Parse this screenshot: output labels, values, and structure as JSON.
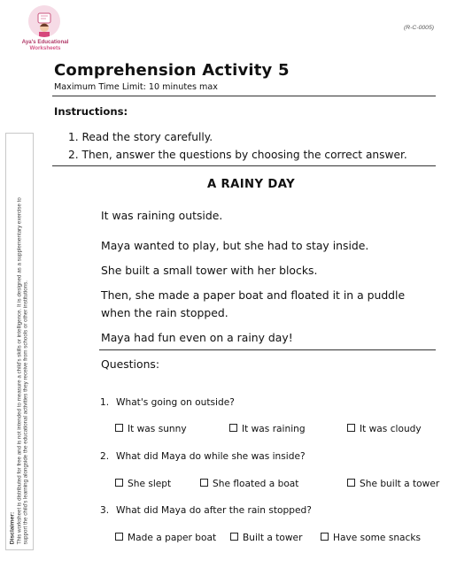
{
  "header": {
    "logo_line1": "Aya's Educational",
    "logo_line2": "Worksheets",
    "code": "(R-C-0005)",
    "title": "Comprehension Activity 5",
    "time_limit": "Maximum Time Limit: 10 minutes max"
  },
  "instructions": {
    "heading": "Instructions:",
    "items": [
      "1.  Read the story carefully.",
      "2.  Then, answer the questions by choosing the correct answer."
    ]
  },
  "story": {
    "title": "A RAINY DAY",
    "paragraphs": [
      "It was raining outside.",
      "Maya wanted to play, but she had to stay inside.",
      "She built a small tower with her blocks.",
      "Then, she made a paper boat and floated it in a puddle when the rain stopped.",
      "Maya had fun even on a rainy day!"
    ]
  },
  "questions": {
    "heading": "Questions:",
    "items": [
      {
        "num": "1.",
        "text": "What's going on outside?",
        "options": [
          "It was sunny",
          "It was raining",
          "It was cloudy"
        ]
      },
      {
        "num": "2.",
        "text": "What did Maya do while she was inside?",
        "options": [
          "She slept",
          "She floated a boat",
          "She built a tower"
        ]
      },
      {
        "num": "3.",
        "text": "What did Maya do after the rain stopped?",
        "options": [
          "Made a paper boat",
          "Built a tower",
          "Have some snacks"
        ]
      }
    ]
  },
  "disclaimer": {
    "heading": "Disclaimer:",
    "line1": "This worksheet is distributed for free and is not intended to measure a child's skills or intelligence. It is designed as a supplementary exercise to",
    "line2": "support the child's learning alongside the educational activities they receive from schools or other institutions."
  }
}
